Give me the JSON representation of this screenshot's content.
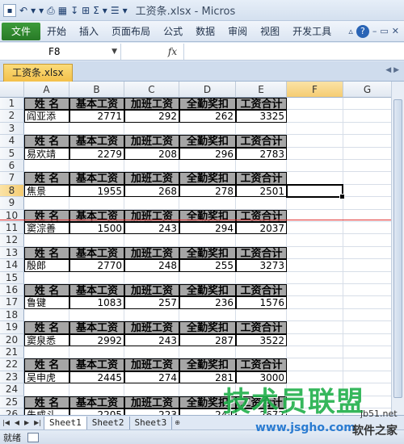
{
  "window": {
    "title": "工资条.xlsx - Micros",
    "qat": [
      "■",
      "↶",
      "▾",
      "▾",
      "⎙",
      "▾",
      "Σ",
      "▾"
    ]
  },
  "ribbon": {
    "file_tab": "文件",
    "tabs": [
      "开始",
      "插入",
      "页面布局",
      "公式",
      "数据",
      "审阅",
      "视图",
      "开发工具"
    ],
    "help": "?"
  },
  "formula_bar": {
    "name_box": "F8",
    "fx": "fx",
    "value": ""
  },
  "workbook_tab": "工资条.xlsx",
  "columns": [
    "A",
    "B",
    "C",
    "D",
    "E",
    "F",
    "G"
  ],
  "rows": [
    "1",
    "2",
    "3",
    "4",
    "5",
    "6",
    "7",
    "8",
    "9",
    "10",
    "11",
    "12",
    "13",
    "14",
    "15",
    "16",
    "17",
    "18",
    "19",
    "20",
    "21",
    "22",
    "23",
    "24",
    "25",
    "26"
  ],
  "selected_cell": "F8",
  "table": {
    "headers": [
      "姓  名",
      "基本工资",
      "加班工资",
      "全勤奖扣",
      "工资合计"
    ],
    "records": [
      {
        "name": "阎亚添",
        "base": "2771",
        "overtime": "292",
        "bonus": "262",
        "total": "3325"
      },
      {
        "name": "易欢靖",
        "base": "2279",
        "overtime": "208",
        "bonus": "296",
        "total": "2783"
      },
      {
        "name": "焦景",
        "base": "1955",
        "overtime": "268",
        "bonus": "278",
        "total": "2501"
      },
      {
        "name": "窦淙善",
        "base": "1500",
        "overtime": "243",
        "bonus": "294",
        "total": "2037"
      },
      {
        "name": "殷郎",
        "base": "2770",
        "overtime": "248",
        "bonus": "255",
        "total": "3273"
      },
      {
        "name": "鲁键",
        "base": "1083",
        "overtime": "257",
        "bonus": "236",
        "total": "1576"
      },
      {
        "name": "窦泉悉",
        "base": "2992",
        "overtime": "243",
        "bonus": "287",
        "total": "3522"
      },
      {
        "name": "吴申虎",
        "base": "2445",
        "overtime": "274",
        "bonus": "281",
        "total": "3000"
      },
      {
        "name": "朱成斗",
        "base": "2205",
        "overtime": "223",
        "bonus": "244",
        "total": "2672"
      }
    ]
  },
  "sheets": [
    "Sheet1",
    "Sheet2",
    "Sheet3"
  ],
  "status": {
    "ready": "就绪"
  },
  "watermark": {
    "brand": "技术员联盟",
    "site": "www.jsgho.com",
    "side": "软件之家",
    "top": "jb51.net"
  }
}
